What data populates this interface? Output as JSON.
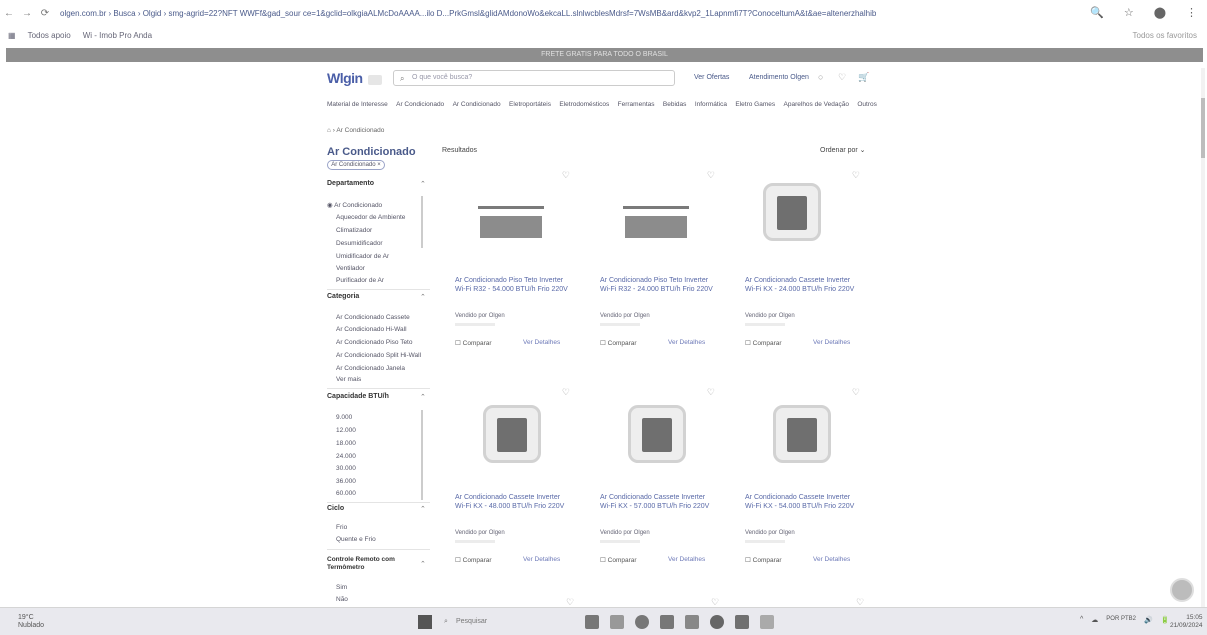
{
  "browser": {
    "url": "olgen.com.br › Busca › Olgid › smg-agrid=22?NFT WWFf&gad_sour ce=1&gclid=olkgiaALMcDoAAAA...ilo D...PrkGmsl&glidAMdonoWo&ekcaLL.slnlwcblesMdrsf=7WsMB&ard&kvp2_1Lapnmfi7T?ConoceltumA&t&ae=altenerzhalhib",
    "nav_back": "←",
    "nav_forward": "→",
    "nav_reload": "⟳",
    "right_icons": [
      "🔍",
      "☆",
      "⬤",
      "⋮"
    ],
    "bookmarks": [
      "Todos apoio",
      "Wi - Imob Pro Anda"
    ],
    "all_bookmarks": "Todos os favoritos"
  },
  "banner": "FRETE GRATIS PARA TODO O BRASIL",
  "header": {
    "logo": "Wlgin",
    "search_placeholder": "O que você busca?",
    "links": [
      "Ver Ofertas",
      "Atendimento Olgen",
      "Entrar"
    ]
  },
  "categories": [
    "Material de Interesse",
    "Ar Condicionado",
    "Ar Condicionado",
    "Eletroportáteis",
    "Eletrodomésticos",
    "Ferramentas",
    "Bebidas",
    "Informática",
    "Eletro Games",
    "Aparelhos de Vedação",
    "Outros"
  ],
  "breadcrumb": "⌂ › Ar Condicionado",
  "sidebar": {
    "title": "Ar Condicionado",
    "chip": "Ar Condicionado ×",
    "sections": [
      {
        "title": "Departamento",
        "items": [
          "◉ Ar Condicionado",
          "Aquecedor de Ambiente",
          "Climatizador",
          "Desumidificador",
          "Umidificador de Ar",
          "Ventilador",
          "Purificador de Ar"
        ]
      },
      {
        "title": "Categoria",
        "items": [
          "Ar Condicionado Cassete",
          "Ar Condicionado Hi-Wall",
          "Ar Condicionado Piso Teto",
          "Ar Condicionado Split Hi-Wall",
          "Ar Condicionado Janela",
          "Ver mais"
        ]
      },
      {
        "title": "Capacidade BTU/h",
        "items": [
          "9.000",
          "12.000",
          "18.000",
          "24.000",
          "30.000",
          "36.000",
          "60.000"
        ]
      },
      {
        "title": "Ciclo",
        "items": [
          "Frio",
          "Quente e Frio"
        ]
      },
      {
        "title": "Controle Remoto com Termômetro",
        "items": [
          "Sim",
          "Não"
        ]
      }
    ]
  },
  "results": {
    "label": "Resultados",
    "sort": "Ordenar por  ⌄"
  },
  "products": [
    {
      "title": "Ar Condicionado Piso Teto Inverter Wi-Fi R32 - 54.000 BTU/h Frio 220V",
      "seller": "Vendido por Olgen",
      "compare": "☐ Comparar",
      "more": "Ver Detalhes",
      "img": "wide"
    },
    {
      "title": "Ar Condicionado Piso Teto Inverter Wi-Fi R32 - 24.000 BTU/h Frio 220V",
      "seller": "Vendido por Olgen",
      "compare": "☐ Comparar",
      "more": "Ver Detalhes",
      "img": "wide"
    },
    {
      "title": "Ar Condicionado Cassete Inverter Wi-Fi KX - 24.000 BTU/h Frio 220V",
      "seller": "Vendido por Olgen",
      "compare": "☐ Comparar",
      "more": "Ver Detalhes",
      "img": "cassette"
    },
    {
      "title": "Ar Condicionado Cassete Inverter Wi-Fi KX - 48.000 BTU/h Frio 220V",
      "seller": "Vendido por Olgen",
      "compare": "☐ Comparar",
      "more": "Ver Detalhes",
      "img": "cassette"
    },
    {
      "title": "Ar Condicionado Cassete Inverter Wi-Fi KX - 57.000 BTU/h Frio 220V",
      "seller": "Vendido por Olgen",
      "compare": "☐ Comparar",
      "more": "Ver Detalhes",
      "img": "cassette"
    },
    {
      "title": "Ar Condicionado Cassete Inverter Wi-Fi KX - 54.000 BTU/h Frio 220V",
      "seller": "Vendido por Olgen",
      "compare": "☐ Comparar",
      "more": "Ver Detalhes",
      "img": "cassette"
    }
  ],
  "taskbar": {
    "weather_temp": "19°C",
    "weather_desc": "Nublado",
    "search": "Pesquisar",
    "tray": [
      "^",
      "☁",
      "POR PTB2",
      "🔊",
      "🔋"
    ],
    "time": "15:05",
    "date": "21/09/2024"
  }
}
